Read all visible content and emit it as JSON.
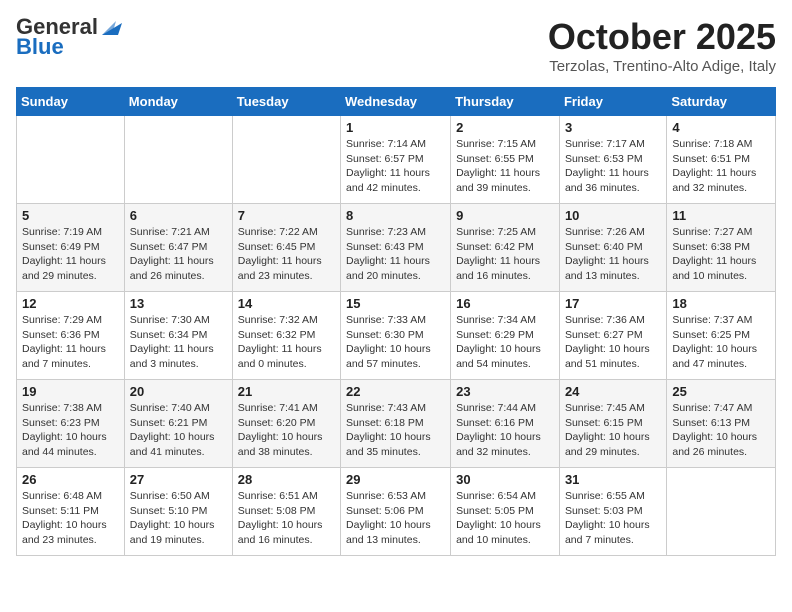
{
  "header": {
    "logo_general": "General",
    "logo_blue": "Blue",
    "month": "October 2025",
    "location": "Terzolas, Trentino-Alto Adige, Italy"
  },
  "days_of_week": [
    "Sunday",
    "Monday",
    "Tuesday",
    "Wednesday",
    "Thursday",
    "Friday",
    "Saturday"
  ],
  "weeks": [
    [
      {
        "day": "",
        "info": ""
      },
      {
        "day": "",
        "info": ""
      },
      {
        "day": "",
        "info": ""
      },
      {
        "day": "1",
        "info": "Sunrise: 7:14 AM\nSunset: 6:57 PM\nDaylight: 11 hours and 42 minutes."
      },
      {
        "day": "2",
        "info": "Sunrise: 7:15 AM\nSunset: 6:55 PM\nDaylight: 11 hours and 39 minutes."
      },
      {
        "day": "3",
        "info": "Sunrise: 7:17 AM\nSunset: 6:53 PM\nDaylight: 11 hours and 36 minutes."
      },
      {
        "day": "4",
        "info": "Sunrise: 7:18 AM\nSunset: 6:51 PM\nDaylight: 11 hours and 32 minutes."
      }
    ],
    [
      {
        "day": "5",
        "info": "Sunrise: 7:19 AM\nSunset: 6:49 PM\nDaylight: 11 hours and 29 minutes."
      },
      {
        "day": "6",
        "info": "Sunrise: 7:21 AM\nSunset: 6:47 PM\nDaylight: 11 hours and 26 minutes."
      },
      {
        "day": "7",
        "info": "Sunrise: 7:22 AM\nSunset: 6:45 PM\nDaylight: 11 hours and 23 minutes."
      },
      {
        "day": "8",
        "info": "Sunrise: 7:23 AM\nSunset: 6:43 PM\nDaylight: 11 hours and 20 minutes."
      },
      {
        "day": "9",
        "info": "Sunrise: 7:25 AM\nSunset: 6:42 PM\nDaylight: 11 hours and 16 minutes."
      },
      {
        "day": "10",
        "info": "Sunrise: 7:26 AM\nSunset: 6:40 PM\nDaylight: 11 hours and 13 minutes."
      },
      {
        "day": "11",
        "info": "Sunrise: 7:27 AM\nSunset: 6:38 PM\nDaylight: 11 hours and 10 minutes."
      }
    ],
    [
      {
        "day": "12",
        "info": "Sunrise: 7:29 AM\nSunset: 6:36 PM\nDaylight: 11 hours and 7 minutes."
      },
      {
        "day": "13",
        "info": "Sunrise: 7:30 AM\nSunset: 6:34 PM\nDaylight: 11 hours and 3 minutes."
      },
      {
        "day": "14",
        "info": "Sunrise: 7:32 AM\nSunset: 6:32 PM\nDaylight: 11 hours and 0 minutes."
      },
      {
        "day": "15",
        "info": "Sunrise: 7:33 AM\nSunset: 6:30 PM\nDaylight: 10 hours and 57 minutes."
      },
      {
        "day": "16",
        "info": "Sunrise: 7:34 AM\nSunset: 6:29 PM\nDaylight: 10 hours and 54 minutes."
      },
      {
        "day": "17",
        "info": "Sunrise: 7:36 AM\nSunset: 6:27 PM\nDaylight: 10 hours and 51 minutes."
      },
      {
        "day": "18",
        "info": "Sunrise: 7:37 AM\nSunset: 6:25 PM\nDaylight: 10 hours and 47 minutes."
      }
    ],
    [
      {
        "day": "19",
        "info": "Sunrise: 7:38 AM\nSunset: 6:23 PM\nDaylight: 10 hours and 44 minutes."
      },
      {
        "day": "20",
        "info": "Sunrise: 7:40 AM\nSunset: 6:21 PM\nDaylight: 10 hours and 41 minutes."
      },
      {
        "day": "21",
        "info": "Sunrise: 7:41 AM\nSunset: 6:20 PM\nDaylight: 10 hours and 38 minutes."
      },
      {
        "day": "22",
        "info": "Sunrise: 7:43 AM\nSunset: 6:18 PM\nDaylight: 10 hours and 35 minutes."
      },
      {
        "day": "23",
        "info": "Sunrise: 7:44 AM\nSunset: 6:16 PM\nDaylight: 10 hours and 32 minutes."
      },
      {
        "day": "24",
        "info": "Sunrise: 7:45 AM\nSunset: 6:15 PM\nDaylight: 10 hours and 29 minutes."
      },
      {
        "day": "25",
        "info": "Sunrise: 7:47 AM\nSunset: 6:13 PM\nDaylight: 10 hours and 26 minutes."
      }
    ],
    [
      {
        "day": "26",
        "info": "Sunrise: 6:48 AM\nSunset: 5:11 PM\nDaylight: 10 hours and 23 minutes."
      },
      {
        "day": "27",
        "info": "Sunrise: 6:50 AM\nSunset: 5:10 PM\nDaylight: 10 hours and 19 minutes."
      },
      {
        "day": "28",
        "info": "Sunrise: 6:51 AM\nSunset: 5:08 PM\nDaylight: 10 hours and 16 minutes."
      },
      {
        "day": "29",
        "info": "Sunrise: 6:53 AM\nSunset: 5:06 PM\nDaylight: 10 hours and 13 minutes."
      },
      {
        "day": "30",
        "info": "Sunrise: 6:54 AM\nSunset: 5:05 PM\nDaylight: 10 hours and 10 minutes."
      },
      {
        "day": "31",
        "info": "Sunrise: 6:55 AM\nSunset: 5:03 PM\nDaylight: 10 hours and 7 minutes."
      },
      {
        "day": "",
        "info": ""
      }
    ]
  ]
}
